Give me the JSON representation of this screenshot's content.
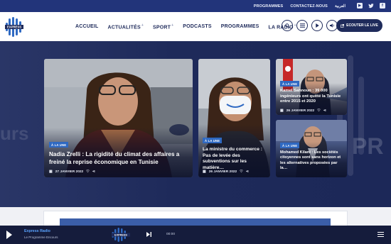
{
  "topbar": {
    "links": [
      "PROGRAMMES",
      "CONTACTEZ-NOUS",
      "العربية"
    ],
    "social": [
      "youtube-icon",
      "twitter-icon",
      "facebook-icon"
    ]
  },
  "header": {
    "logo_text": "EXPRESS",
    "nav": [
      {
        "label": "ACCUEIL",
        "active": true,
        "plus": false
      },
      {
        "label": "ACTUALITÉS",
        "active": false,
        "plus": true
      },
      {
        "label": "SPORT",
        "active": false,
        "plus": true
      },
      {
        "label": "PODCASTS",
        "active": false,
        "plus": false
      },
      {
        "label": "PROGRAMMES",
        "active": false,
        "plus": false
      },
      {
        "label": "LA RADIO",
        "active": false,
        "plus": true
      }
    ],
    "plus_glyph": "+",
    "live_button": "ECOUTER LE LIVE"
  },
  "cards": [
    {
      "badge": "À LA UNE",
      "title": "Nadia Zrelli : La rigidité du climat des affaires a freiné la reprise économique en Tunisie",
      "date": "27 JANVIER 2022"
    },
    {
      "badge": "À LA UNE",
      "title": "La ministre du commerce : Pas de levée des subventions sur les matière…",
      "date": "26 JANVIER 2022"
    },
    {
      "badge": "À LA UNE",
      "title": "Kamel Sahnoun : 39 000 ingénieurs ont quitté la Tunisie entre 2015 et 2020",
      "date": "26 JANVIER 2022"
    },
    {
      "badge": "À LA UNE",
      "title": "Mohamed Kilani : Les sociétés citoyennes sont sans horizon et les alternatives proposées par la…",
      "date": ""
    }
  ],
  "player": {
    "title": "Express Radio",
    "subtitle": "Le Programme Encours",
    "time": "00:00",
    "logo_text": "EXPRESS"
  },
  "colors": {
    "brand": "#22347a",
    "accent": "#3d7fd0",
    "badge": "#2f69c2"
  }
}
